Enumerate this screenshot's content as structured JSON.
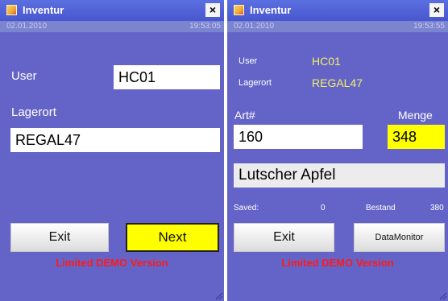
{
  "screen1": {
    "title": "Inventur",
    "close": "×",
    "date": "02.01.2010",
    "time": "19:53:05",
    "user_label": "User",
    "user_value": "HC01",
    "lagerort_label": "Lagerort",
    "lagerort_value": "REGAL47",
    "exit_label": "Exit",
    "next_label": "Next",
    "demo_text": "Limited DEMO Version"
  },
  "screen2": {
    "title": "Inventur",
    "close": "×",
    "date": "02.01.2010",
    "time": "19:53:55",
    "user_label": "User",
    "user_value": "HC01",
    "lagerort_label": "Lagerort",
    "lagerort_value": "REGAL47",
    "art_label": "Art#",
    "art_value": "160",
    "menge_label": "Menge",
    "menge_value": "348",
    "description": "Lutscher Apfel",
    "saved_label": "Saved:",
    "saved_value": "0",
    "bestand_label": "Bestand",
    "bestand_value": "380",
    "exit_label": "Exit",
    "datamonitor_label": "DataMonitor",
    "demo_text": "Limited DEMO Version"
  },
  "colors": {
    "background": "#6464c8",
    "titlebar": "#4857cf",
    "highlight": "#ffff00",
    "demo_text": "#ff1a1a",
    "secondary_value": "#f4f062"
  }
}
